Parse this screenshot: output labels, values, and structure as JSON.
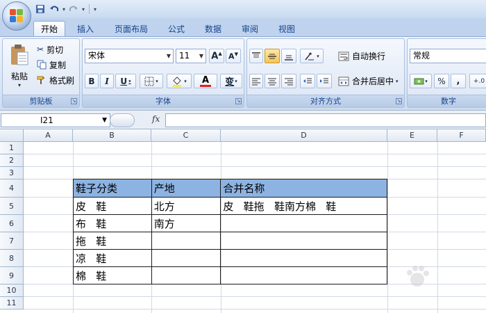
{
  "quick_access": {
    "menu_glyph": "▾"
  },
  "tabs": [
    "开始",
    "插入",
    "页面布局",
    "公式",
    "数据",
    "审阅",
    "视图"
  ],
  "ribbon": {
    "clipboard": {
      "paste": "粘贴",
      "cut": "剪切",
      "copy": "复制",
      "format_painter": "格式刷",
      "label": "剪贴板"
    },
    "font": {
      "name": "宋体",
      "size": "11",
      "bold": "B",
      "italic": "I",
      "underline": "U",
      "phonetic": "变",
      "font_color": "A",
      "label": "字体"
    },
    "alignment": {
      "wrap_text": "自动换行",
      "merge_center": "合并后居中",
      "label": "对齐方式"
    },
    "number": {
      "format": "常规",
      "percent": "%",
      "comma": ",",
      "decimal": "+.0",
      "label": "数字"
    }
  },
  "formula_bar": {
    "name_box": "I21",
    "fx": "fx",
    "content": ""
  },
  "columns": [
    "A",
    "B",
    "C",
    "D",
    "E",
    "F"
  ],
  "rows": [
    "1",
    "2",
    "3",
    "4",
    "5",
    "6",
    "7",
    "8",
    "9",
    "10",
    "11"
  ],
  "table": {
    "headers": [
      "鞋子分类",
      "产地",
      "合并名称"
    ],
    "rows": [
      [
        "皮   鞋",
        "北方",
        "皮   鞋拖   鞋南方棉   鞋"
      ],
      [
        "布   鞋",
        "南方",
        ""
      ],
      [
        "拖   鞋",
        "",
        ""
      ],
      [
        "凉   鞋",
        "",
        ""
      ],
      [
        "棉   鞋",
        "",
        ""
      ]
    ]
  },
  "colors": {
    "header_fill": "#8db3e2",
    "ribbon": "#dce7f5"
  }
}
